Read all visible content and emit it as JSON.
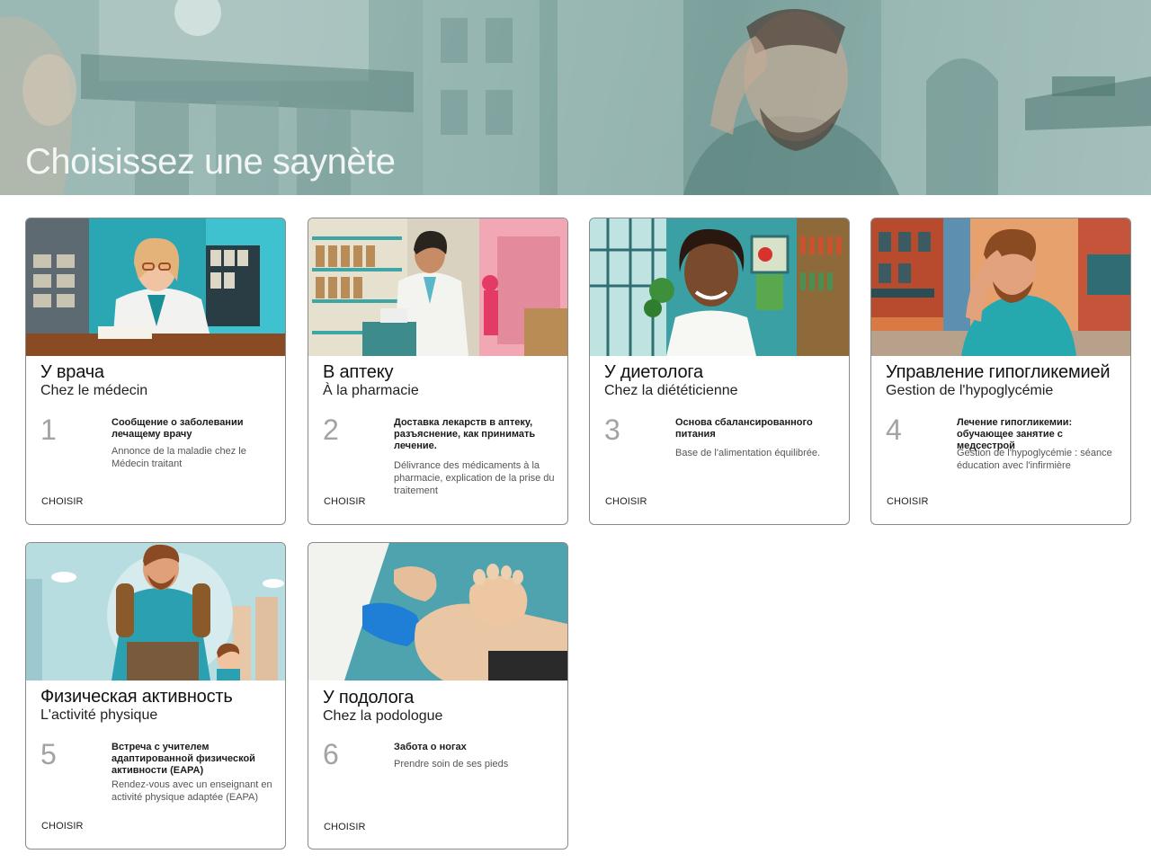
{
  "page": {
    "title": "Choisissez une saynète"
  },
  "cards": [
    {
      "title": "У врача",
      "subtitle": "Chez le médecin",
      "number": "1",
      "desc_ru": "Сообщение о заболевании лечащему врачу",
      "desc_fr": "Annonce de la maladie chez le Médecin traitant",
      "action": "CHOISIR",
      "image_icon": "doctor-illustration-icon"
    },
    {
      "title": "В аптеку",
      "subtitle": "À la pharmacie",
      "number": "2",
      "desc_ru": "Доставка лекарств в аптеку, разъяснение, как принимать лечение.",
      "desc_fr": "Délivrance des médicaments à la pharmacie, explication de la prise du traitement",
      "action": "CHOISIR",
      "image_icon": "pharmacist-illustration-icon"
    },
    {
      "title": "У диетолога",
      "subtitle": "Chez la diététicienne",
      "number": "3",
      "desc_ru": "Основа сбалансированного питания",
      "desc_fr": "Base de l'alimentation équilibrée.",
      "action": "CHOISIR",
      "image_icon": "dietitian-illustration-icon"
    },
    {
      "title": "Управление гипогликемией",
      "subtitle": "Gestion de l'hypoglycémie",
      "number": "4",
      "desc_ru": "Лечение гипогликемии: обучающее занятие с медсестрой",
      "desc_fr": "Gestion de l'hypoglycémie : séance éducation avec l'infirmière",
      "action": "CHOISIR",
      "image_icon": "dizzy-man-illustration-icon"
    },
    {
      "title": "Физическая активность",
      "subtitle": "L'activité physique",
      "number": "5",
      "desc_ru": "Встреча с учителем адаптированной физической активности (EAPA)",
      "desc_fr": "Rendez-vous avec un enseignant en activité physique adaptée (EAPA)",
      "action": "CHOISIR",
      "image_icon": "hiker-illustration-icon"
    },
    {
      "title": "У подолога",
      "subtitle": "Chez la podologue",
      "number": "6",
      "desc_ru": "Забота о ногах",
      "desc_fr": "Prendre soin de ses pieds",
      "action": "CHOISIR",
      "image_icon": "foot-care-illustration-icon"
    }
  ],
  "colors": {
    "hero_tint": "#8fb0ab",
    "card_border": "#8a8a8a",
    "number_gray": "#a3a3a3"
  }
}
